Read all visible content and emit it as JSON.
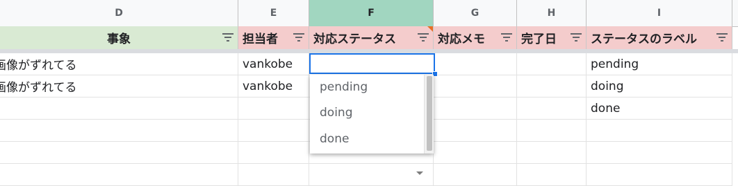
{
  "columns": [
    "D",
    "E",
    "F",
    "G",
    "H",
    "I"
  ],
  "headers": {
    "D": "事象",
    "E": "担当者",
    "F": "対応ステータス",
    "G": "対応メモ",
    "H": "完了日",
    "I": "ステータスのラベル"
  },
  "rows": [
    {
      "D": "画像がずれてる",
      "E": "vankobe",
      "F": "",
      "G": "",
      "H": "",
      "I": "pending"
    },
    {
      "D": "画像がずれてる",
      "E": "vankobe",
      "F": "",
      "G": "",
      "H": "",
      "I": "doing"
    },
    {
      "D": "",
      "E": "",
      "F": "",
      "G": "",
      "H": "",
      "I": "done"
    },
    {
      "D": "",
      "E": "",
      "F": "",
      "G": "",
      "H": "",
      "I": ""
    },
    {
      "D": "",
      "E": "",
      "F": "",
      "G": "",
      "H": "",
      "I": ""
    },
    {
      "D": "",
      "E": "",
      "F": "",
      "G": "",
      "H": "",
      "I": ""
    }
  ],
  "dropdown": {
    "options": [
      "pending",
      "doing",
      "done"
    ]
  },
  "colors": {
    "selected_col": "#a1d6c0",
    "header_red": "#f4cccc",
    "header_green": "#d9ead3",
    "active_border": "#1a73e8"
  }
}
